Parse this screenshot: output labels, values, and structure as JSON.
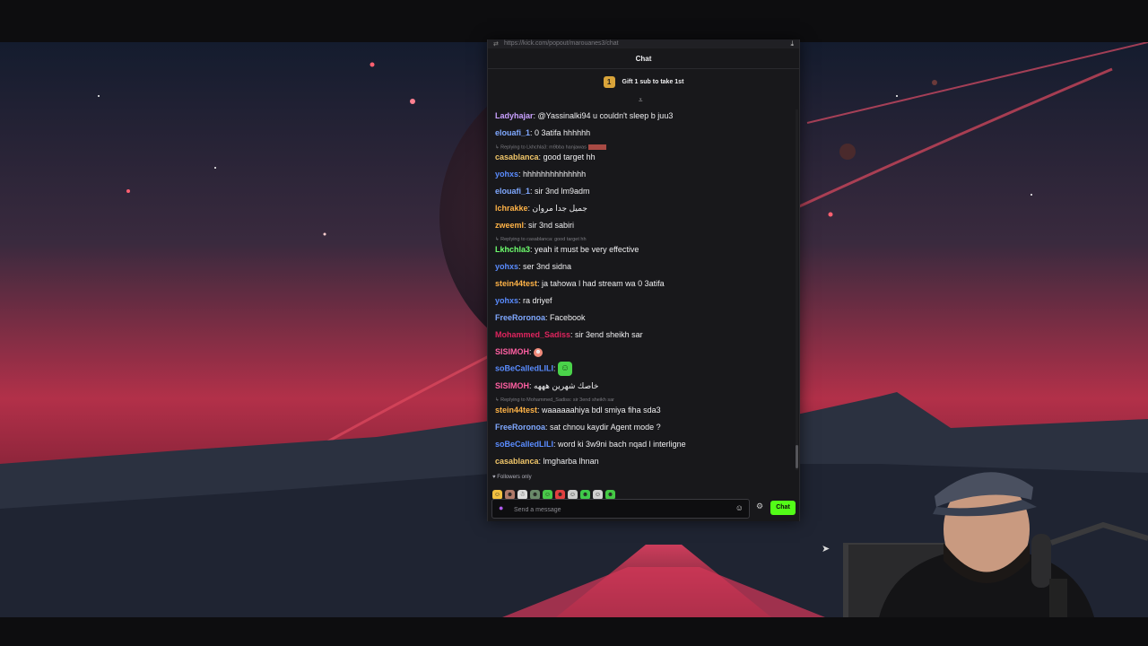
{
  "browser": {
    "url": "https://kick.com/popout/marouanes3/chat"
  },
  "chat": {
    "title": "Chat",
    "gift": {
      "badge": "1",
      "text": "Gift 1 sub to take 1st"
    },
    "messages": [
      {
        "user": "Ladyhajar",
        "color": "#c9a0ff",
        "text": "@Yassinalki94 u couldn't sleep b juu3"
      },
      {
        "user": "elouafi_1",
        "color": "#7fa8ff",
        "text": "0 3atifa hhhhhh"
      },
      {
        "reply": "Replying to Lkhchla3: m9bba hanjawas",
        "user": "casablanca",
        "color": "#f2c76a",
        "text": "good target hh"
      },
      {
        "user": "yohxs",
        "color": "#5a8cff",
        "text": "hhhhhhhhhhhhhh"
      },
      {
        "user": "elouafi_1",
        "color": "#7fa8ff",
        "text": "sir 3nd lm9adm"
      },
      {
        "user": "lchrakke",
        "color": "#ffb347",
        "text": "جميل جدا مروان"
      },
      {
        "user": "zweeml",
        "color": "#ffb347",
        "text": "sir 3nd sabiri"
      },
      {
        "reply": "Replying to casablanca: good target hh",
        "user": "Lkhchla3",
        "color": "#6eff6e",
        "text": "yeah it must be very effective"
      },
      {
        "user": "yohxs",
        "color": "#5a8cff",
        "text": "ser 3nd sidna"
      },
      {
        "user": "stein44test",
        "color": "#ffb347",
        "text": "ja tahowa l had stream wa 0 3atifa"
      },
      {
        "user": "yohxs",
        "color": "#5a8cff",
        "text": "ra driyef"
      },
      {
        "user": "FreeRoronoa",
        "color": "#7fa8ff",
        "text": "Facebook"
      },
      {
        "user": "Mohammed_Sadiss",
        "color": "#e0245e",
        "text": "sir 3end sheikh sar"
      },
      {
        "user": "SISIMOH",
        "color": "#ff5fa2",
        "text": ""
      },
      {
        "user": "soBeCalledLILI",
        "color": "#5a8cff",
        "text": ""
      },
      {
        "user": "SISIMOH",
        "color": "#ff5fa2",
        "text": "خاصك شهرين هههه"
      },
      {
        "reply": "Replying to Mohammed_Sadiss: sir 3end sheikh sar",
        "user": "stein44test",
        "color": "#ffb347",
        "text": "waaaaaahiya bdl smiya fiha sda3"
      },
      {
        "user": "FreeRoronoa",
        "color": "#7fa8ff",
        "text": "sat chnou kaydir Agent mode ?"
      },
      {
        "user": "soBeCalledLILI",
        "color": "#5a8cff",
        "text": "word ki 3w9ni bach nqad l interligne"
      },
      {
        "user": "casablanca",
        "color": "#f2c76a",
        "text": "lmgharba lhnan"
      }
    ],
    "followers_only": "Followers only",
    "input_placeholder": "Send a message",
    "send_label": "Chat"
  },
  "colors": {
    "accent": "#53fc18",
    "panel": "#18181b"
  }
}
